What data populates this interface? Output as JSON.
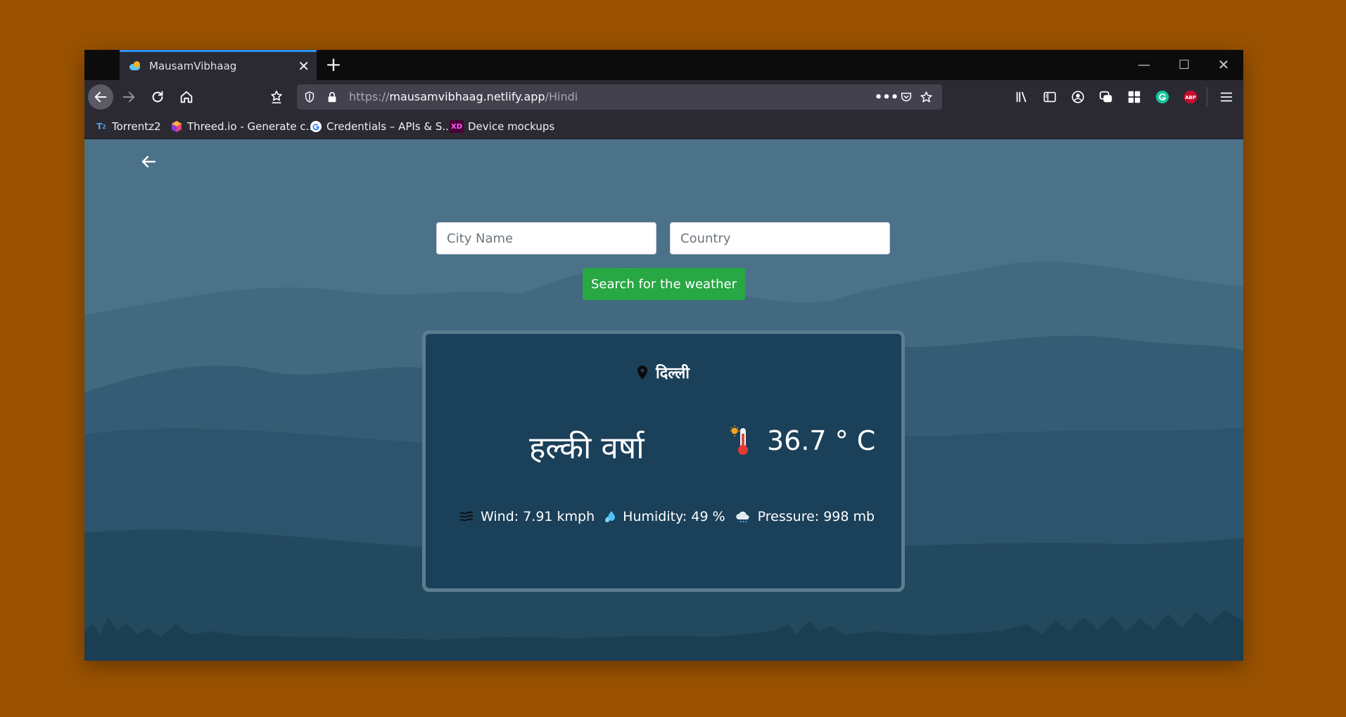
{
  "browser": {
    "tab_title": "MausamVibhaag",
    "url_scheme": "https://",
    "url_host": "mausamvibhaag.netlify.app",
    "url_path": "/Hindi",
    "bookmarks": [
      {
        "label": "Torrentz2",
        "icon": "torrentz-icon"
      },
      {
        "label": "Threed.io - Generate c...",
        "icon": "threed-icon"
      },
      {
        "label": "Credentials – APIs & S...",
        "icon": "google-icon"
      },
      {
        "label": "Device mockups",
        "icon": "xd-icon"
      }
    ],
    "extension_abp_label": "ABP"
  },
  "search": {
    "city_placeholder": "City Name",
    "country_placeholder": "Country",
    "city_value": "",
    "country_value": "",
    "button_label": "Search for the weather"
  },
  "weather": {
    "location": "दिल्ली",
    "description": "हल्की वर्षा",
    "temperature": "36.7 ° C",
    "wind": "Wind: 7.91 kmph",
    "humidity": "Humidity: 49 %",
    "pressure": "Pressure: 998 mb"
  },
  "colors": {
    "page_background": "#9a5200",
    "content_sky": "#4b7289",
    "card_background": "#1b4059",
    "search_button": "#28a745",
    "tab_accent": "#2b8ff0"
  }
}
